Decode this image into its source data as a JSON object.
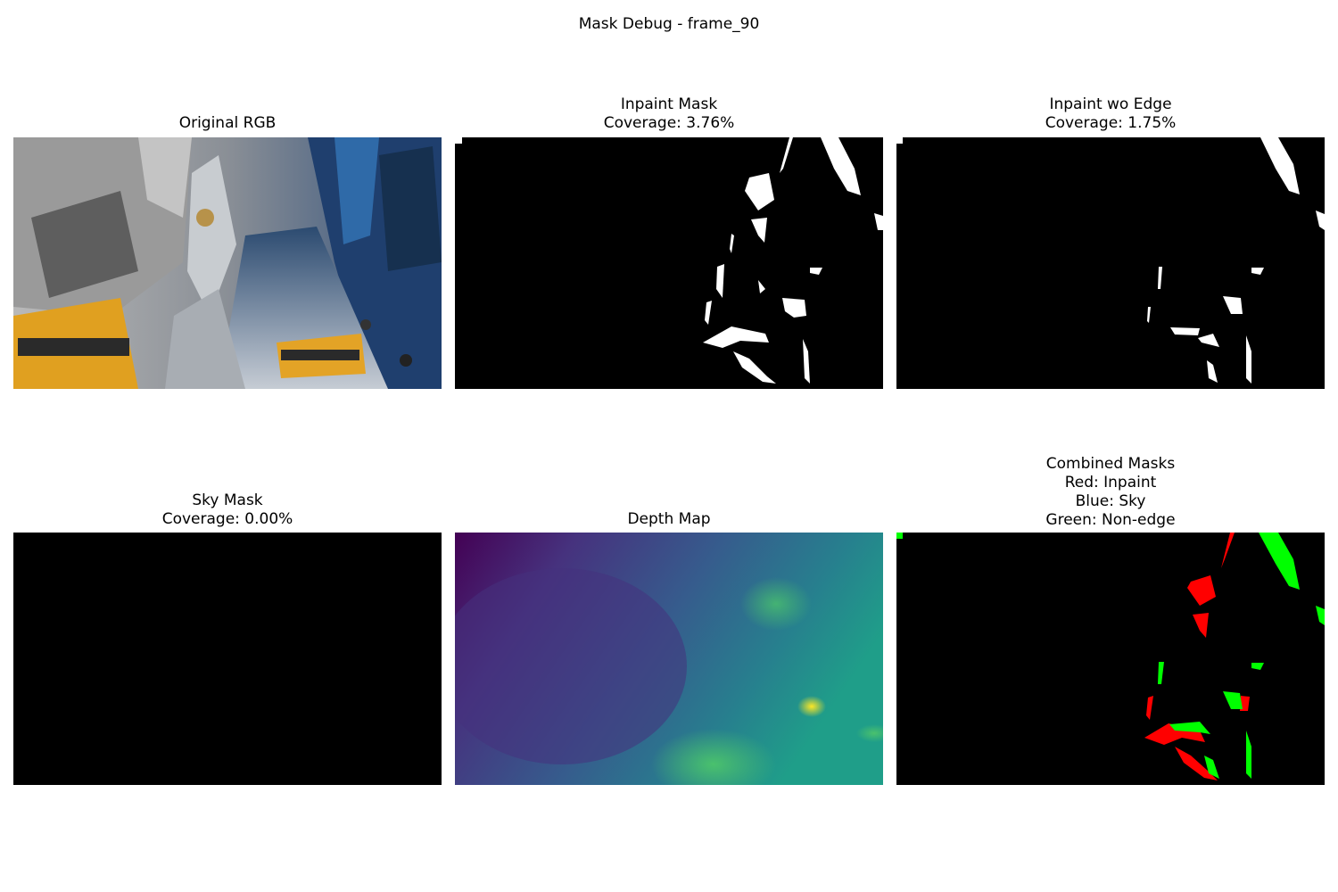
{
  "figure": {
    "suptitle": "Mask Debug - frame_90"
  },
  "panels": {
    "original": {
      "title": "Original RGB"
    },
    "inpaint": {
      "title": "Inpaint Mask",
      "coverage": "Coverage: 3.76%"
    },
    "inpaint_wo_edge": {
      "title": "Inpaint wo Edge",
      "coverage": "Coverage: 1.75%"
    },
    "sky": {
      "title": "Sky Mask",
      "coverage": "Coverage: 0.00%"
    },
    "depth": {
      "title": "Depth Map"
    },
    "combined": {
      "title": "Combined Masks",
      "legend": [
        "Red: Inpaint",
        "Blue: Sky",
        "Green: Non-edge"
      ]
    }
  },
  "colors": {
    "inpaint": "#ff0000",
    "sky": "#0000ff",
    "non_edge": "#00ff00",
    "depth_low": "#440154",
    "depth_high": "#fde725"
  }
}
